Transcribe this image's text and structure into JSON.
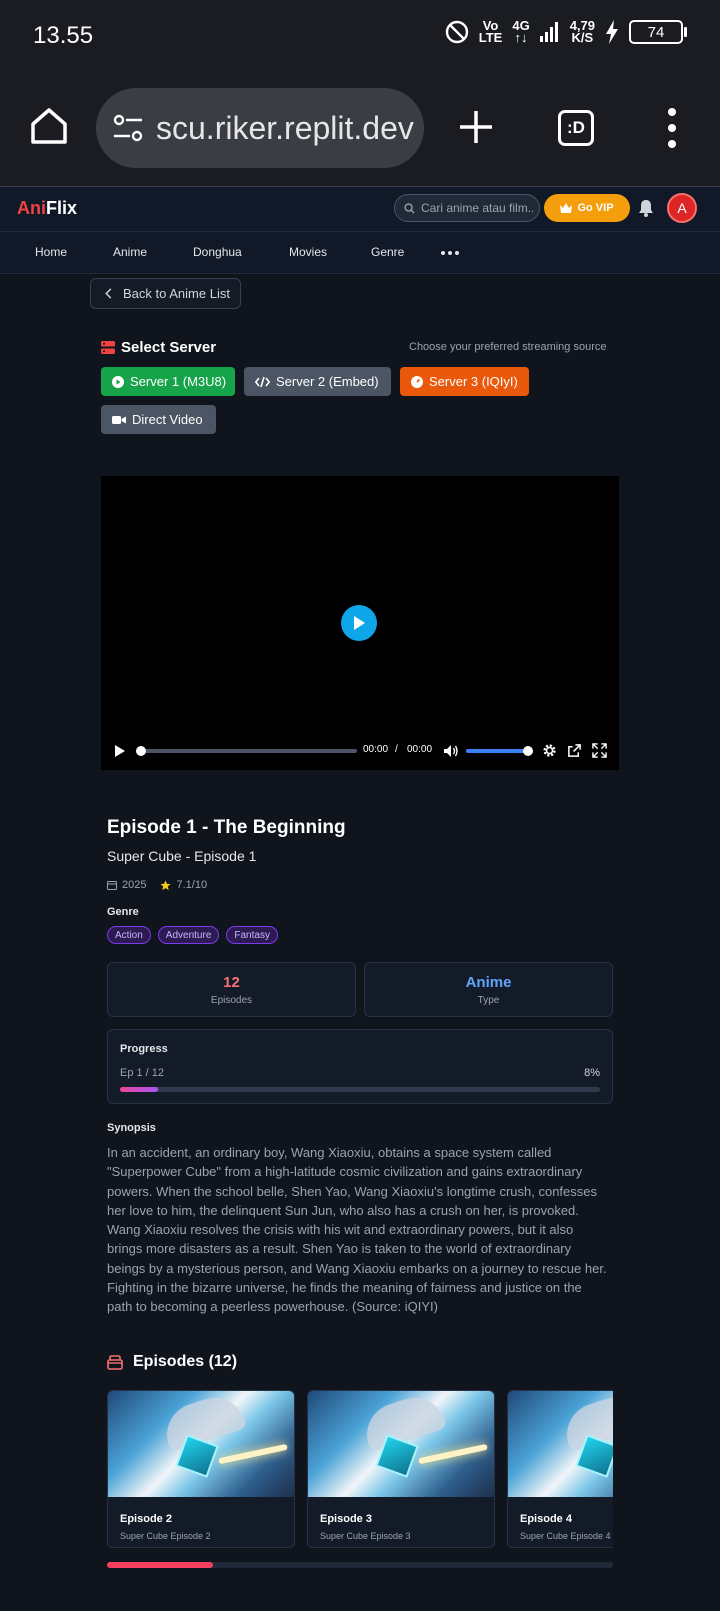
{
  "status_bar": {
    "time": "13.55",
    "net_top": "Vo",
    "net_bottom": "LTE",
    "gen_top": "4G",
    "gen_bottom": "↑↓",
    "speed_top": "4,79",
    "speed_bottom": "K/S",
    "battery": "74"
  },
  "browser": {
    "url": "scu.riker.replit.dev",
    "tabs_label": ":D"
  },
  "header": {
    "logo_a": "Ani",
    "logo_b": "Flix",
    "search_placeholder": "Cari anime atau film...",
    "vip_label": "Go VIP",
    "avatar_letter": "A"
  },
  "nav": {
    "items": [
      "Home",
      "Anime",
      "Donghua",
      "Movies",
      "Genre"
    ]
  },
  "back_label": "Back to Anime List",
  "servers": {
    "title": "Select Server",
    "hint": "Choose your preferred streaming source",
    "buttons": [
      "Server 1 (M3U8)",
      "Server 2 (Embed)",
      "Server 3 (IQIyI)",
      "Direct Video"
    ],
    "colors": [
      "#16a34a",
      "#4b5563",
      "#ea580c",
      "#4b5563"
    ]
  },
  "player": {
    "current": "00:00",
    "separator": "/",
    "duration": "00:00",
    "progress": 0,
    "volume": 1.0
  },
  "episode": {
    "title": "Episode 1 - The Beginning",
    "subtitle": "Super Cube - Episode 1",
    "year": "2025",
    "rating": "7.1/10",
    "genre_heading": "Genre",
    "genres": [
      "Action",
      "Adventure",
      "Fantasy"
    ]
  },
  "stats": [
    {
      "value": "12",
      "label": "Episodes",
      "color": "#f87171"
    },
    {
      "value": "Anime",
      "label": "Type",
      "color": "#60a5fa"
    }
  ],
  "progress": {
    "title": "Progress",
    "episode_text": "Ep 1 / 12",
    "percent_text": "8%",
    "fraction": 0.08
  },
  "synopsis": {
    "heading": "Synopsis",
    "text": "In an accident, an ordinary boy, Wang Xiaoxiu, obtains a space system called \"Superpower Cube\" from a high-latitude cosmic civilization and gains extraordinary powers. When the school belle, Shen Yao, Wang Xiaoxiu's longtime crush, confesses her love to him, the delinquent Sun Jun, who also has a crush on her, is provoked. Wang Xiaoxiu resolves the crisis with his wit and extraordinary powers, but it also brings more disasters as a result. Shen Yao is taken to the world of extraordinary beings by a mysterious person, and Wang Xiaoxiu embarks on a journey to rescue her. Fighting in the bizarre universe, he finds the meaning of fairness and justice on the path to becoming a peerless powerhouse. (Source: iQIYI)"
  },
  "episodes_section": {
    "heading": "Episodes (12)",
    "cards": [
      {
        "title": "Episode 2",
        "subtitle": "Super Cube Episode 2"
      },
      {
        "title": "Episode 3",
        "subtitle": "Super Cube Episode 3"
      },
      {
        "title": "Episode 4",
        "subtitle": "Super Cube Episode 4"
      }
    ],
    "scroll_fraction": 0.21
  }
}
